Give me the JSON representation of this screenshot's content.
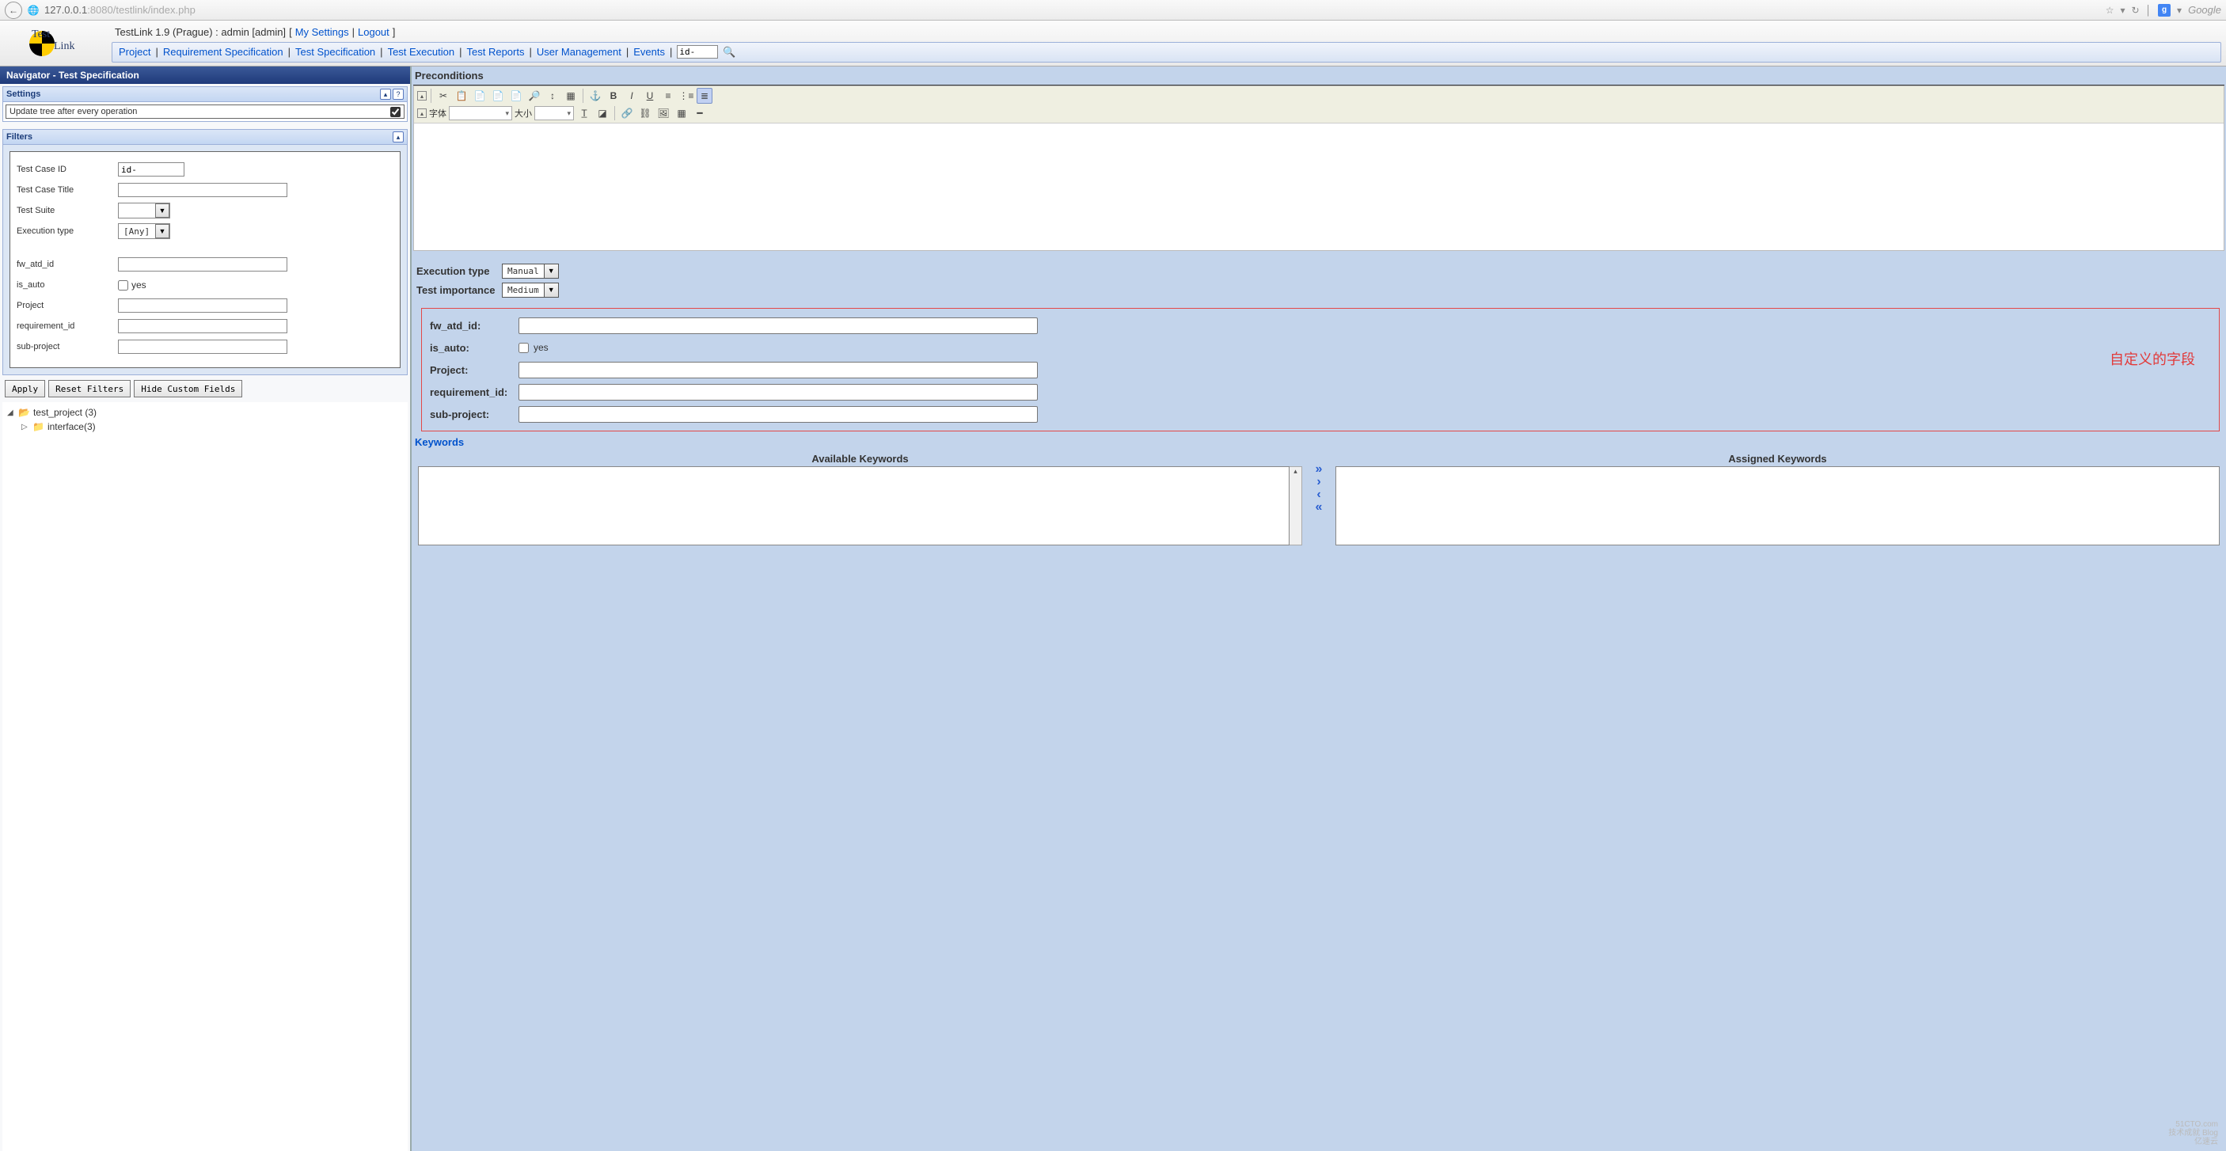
{
  "browser": {
    "url_host": "127.0.0.1",
    "url_port_path": ":8080/testlink/index.php",
    "search_placeholder": "Google"
  },
  "header": {
    "identity_prefix": "TestLink 1.9 (Prague) : admin [admin]",
    "bracket_open": "[",
    "my_settings": "My Settings",
    "sep": " | ",
    "logout": "Logout",
    "bracket_close": "]",
    "nav": {
      "project": "Project",
      "reqspec": "Requirement Specification",
      "testspec": "Test Specification",
      "testexec": "Test Execution",
      "testreports": "Test Reports",
      "usermgmt": "User Management",
      "events": "Events"
    },
    "quick_search_value": "id-",
    "logo_line1": "Test",
    "logo_line2": "Link"
  },
  "navigator": {
    "title": "Navigator - Test Specification",
    "settings_label": "Settings",
    "filters_label": "Filters",
    "update_tree_label": "Update tree after every operation",
    "update_tree_checked": true,
    "filters": {
      "tc_id_label": "Test Case ID",
      "tc_id_value": "id-",
      "tc_title_label": "Test Case Title",
      "tc_title_value": "",
      "suite_label": "Test Suite",
      "suite_value": "",
      "exec_type_label": "Execution type",
      "exec_type_value": "[Any]",
      "fw_atd_id_label": "fw_atd_id",
      "fw_atd_id_value": "",
      "is_auto_label": "is_auto",
      "is_auto_yes": "yes",
      "is_auto_checked": false,
      "project_label": "Project",
      "project_value": "",
      "req_id_label": "requirement_id",
      "req_id_value": "",
      "sub_project_label": "sub-project",
      "sub_project_value": ""
    },
    "actions": {
      "apply": "Apply",
      "reset": "Reset Filters",
      "hide_cf": "Hide Custom Fields"
    },
    "tree": {
      "root_label": "test_project (3)",
      "child_label": "interface(3)"
    }
  },
  "main": {
    "preconditions_label": "Preconditions",
    "toolbar": {
      "font_label": "字体",
      "size_label": "大小"
    },
    "exec_type_label": "Execution type",
    "exec_type_value": "Manual",
    "importance_label": "Test importance",
    "importance_value": "Medium",
    "cf": {
      "fw_atd_id_label": "fw_atd_id:",
      "fw_atd_id_value": "",
      "is_auto_label": "is_auto:",
      "is_auto_yes": "yes",
      "is_auto_checked": false,
      "project_label": "Project:",
      "project_value": "",
      "req_id_label": "requirement_id:",
      "req_id_value": "",
      "sub_project_label": "sub-project:",
      "sub_project_value": "",
      "annotation": "自定义的字段"
    },
    "keywords_label": "Keywords",
    "available_kw_label": "Available Keywords",
    "assigned_kw_label": "Assigned Keywords"
  },
  "watermark": {
    "l1": "51CTO.com",
    "l2": "技术成就 Blog",
    "l3": "亿速云"
  }
}
